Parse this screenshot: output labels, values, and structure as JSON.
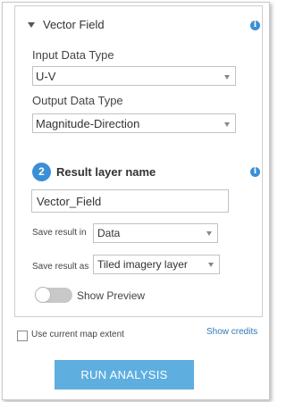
{
  "section": {
    "title": "Vector Field"
  },
  "input_data_type": {
    "label": "Input Data Type",
    "value": "U-V"
  },
  "output_data_type": {
    "label": "Output Data Type",
    "value": "Magnitude-Direction"
  },
  "result": {
    "step_number": "2",
    "title": "Result layer name",
    "layer_name_value": "Vector_Field",
    "save_in_label": "Save result in",
    "save_in_value": "Data",
    "save_as_label": "Save result as",
    "save_as_value": "Tiled imagery layer"
  },
  "preview": {
    "label": "Show Preview",
    "enabled": false
  },
  "footer": {
    "use_extent_label": "Use current map extent",
    "use_extent_checked": false,
    "credits_link": "Show credits",
    "run_button": "RUN ANALYSIS"
  },
  "colors": {
    "accent": "#3b8fd4",
    "button": "#5eaee0",
    "link": "#3079b8"
  },
  "icons": [
    "caret-down-icon",
    "info-icon",
    "select-arrow-icon"
  ]
}
